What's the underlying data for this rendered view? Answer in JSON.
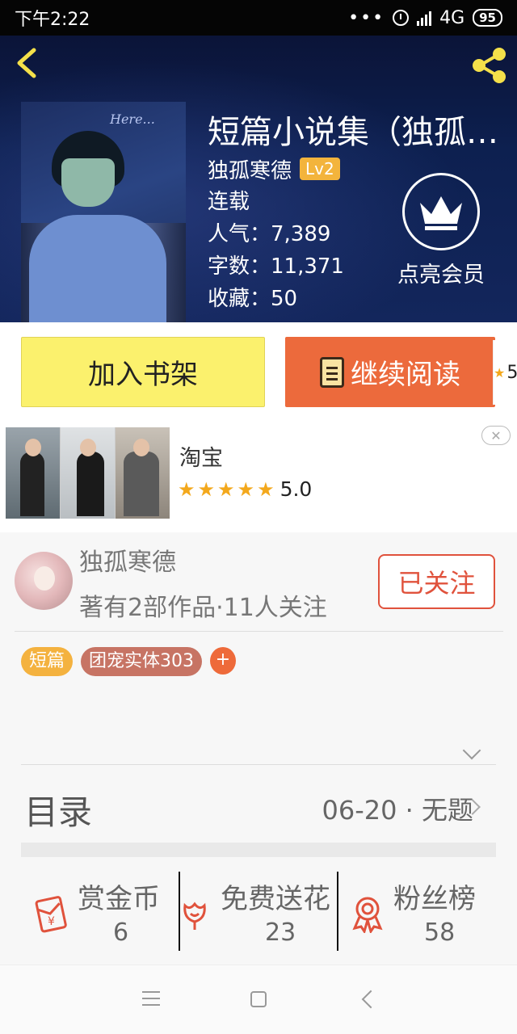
{
  "status_bar": {
    "time": "下午2:22",
    "dots": "•••",
    "network": "4G",
    "battery": "95"
  },
  "header": {
    "book_title": "短篇小说集（独孤…",
    "author": "独孤寒德",
    "level": "Lv2",
    "status": "连载",
    "popularity": "人气：7,389",
    "word_count": "字数：11,371",
    "favorites": "收藏：50",
    "vip_label": "点亮会员",
    "cover_scrawl": "Here..."
  },
  "actions": {
    "add_shelf": "加入书架",
    "continue_read": "继续阅读",
    "peek_value": "5"
  },
  "ad": {
    "title": "淘宝",
    "rating": "5.0",
    "stars": 5,
    "close_symbol": "✕"
  },
  "author_card": {
    "name": "独孤寒德",
    "stats": "著有2部作品·11人关注",
    "follow_label": "已关注"
  },
  "tags": [
    {
      "label": "短篇"
    },
    {
      "label": "团宠实体303"
    },
    {
      "label": "+"
    }
  ],
  "toc": {
    "title": "目录",
    "latest": "06-20 · 无题"
  },
  "stats": [
    {
      "label": "赏金币",
      "value": "6",
      "icon": "red-envelope-icon"
    },
    {
      "label": "免费送花",
      "value": "23",
      "icon": "flower-icon"
    },
    {
      "label": "粉丝榜",
      "value": "58",
      "icon": "medal-icon"
    }
  ],
  "colors": {
    "header_bg": "#0d2050",
    "accent_yellow": "#fbf16d",
    "accent_orange": "#ec6a3c",
    "follow_red": "#e0523c",
    "icon_red": "#e0523c"
  }
}
